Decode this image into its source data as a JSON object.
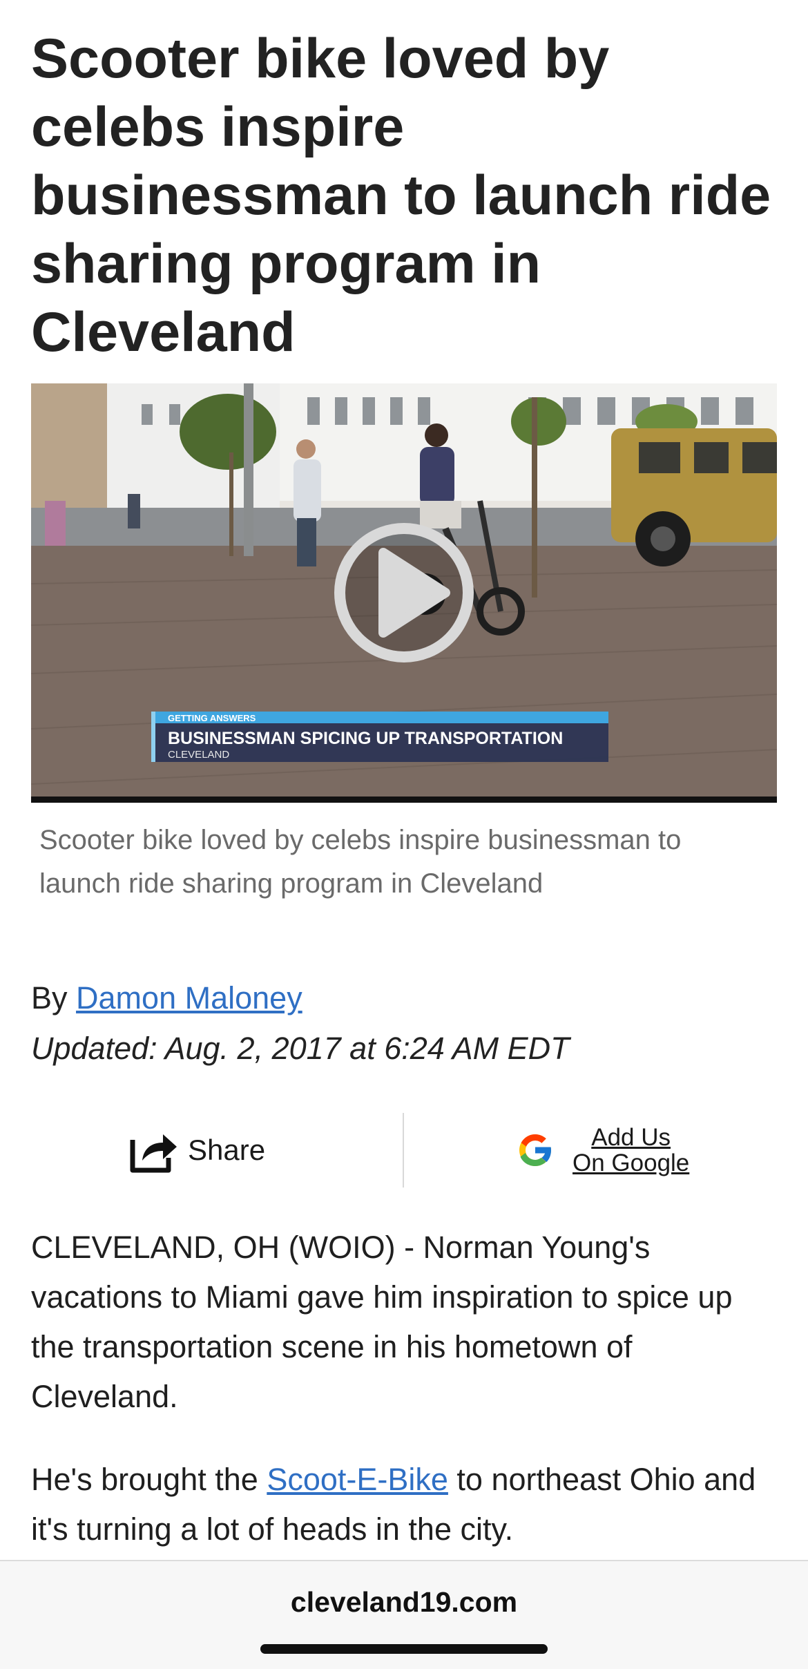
{
  "article": {
    "headline": "Scooter bike loved by celebs inspire businessman to launch ride sharing program in Cleveland",
    "caption": "Scooter bike loved by celebs inspire businessman to launch ride sharing program in Cleveland",
    "byline_prefix": "By ",
    "author": "Damon Maloney",
    "updated": "Updated: Aug. 2, 2017 at 6:24 AM EDT"
  },
  "video": {
    "lower_third_kicker": "GETTING ANSWERS",
    "lower_third_title": "BUSINESSMAN SPICING UP TRANSPORTATION",
    "lower_third_location": "CLEVELAND",
    "play_icon": "play-icon"
  },
  "actions": {
    "share_label": "Share",
    "share_icon": "share-icon",
    "google_line1": "Add Us",
    "google_line2": "On Google",
    "google_icon": "google-g-icon"
  },
  "body": {
    "p1": "CLEVELAND, OH (WOIO) - Norman Young's vacations to Miami gave him inspiration to spice up the transportation scene in his hometown of Cleveland.",
    "p2_before": "He's brought the ",
    "p2_link": "Scoot-E-Bike",
    "p2_after": " to northeast Ohio and it's turning a lot of heads in the city."
  },
  "browser": {
    "domain": "cleveland19.com"
  },
  "colors": {
    "link": "#2f6fc4",
    "lower_third_bar": "#2a3354",
    "lower_third_accent": "#3fa6e0"
  }
}
